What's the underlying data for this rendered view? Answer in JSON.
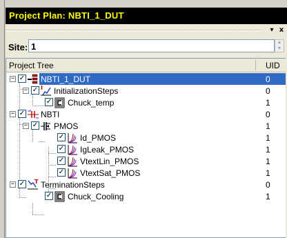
{
  "window": {
    "title": "Project Plan: NBTI_1_DUT"
  },
  "pane_buttons": {
    "menu": "▾",
    "close": "x"
  },
  "site": {
    "label": "Site:",
    "value": "1"
  },
  "tree_header": {
    "name_col": "Project Tree",
    "uid_col": "UID"
  },
  "tree": [
    {
      "label": "NBTI_1_DUT",
      "uid": "0"
    },
    {
      "label": "InitializationSteps",
      "uid": "0"
    },
    {
      "label": "Chuck_temp",
      "uid": "1"
    },
    {
      "label": "NBTI",
      "uid": "0"
    },
    {
      "label": "PMOS",
      "uid": "1"
    },
    {
      "label": "Id_PMOS",
      "uid": "1"
    },
    {
      "label": "IgLeak_PMOS",
      "uid": "1"
    },
    {
      "label": "VtextLin_PMOS",
      "uid": "1"
    },
    {
      "label": "VtextSat_PMOS",
      "uid": "1"
    },
    {
      "label": "TerminationSteps",
      "uid": "0"
    },
    {
      "label": "Chuck_Cooling",
      "uid": "1"
    }
  ],
  "colors": {
    "selection": "#316ac5",
    "title_text": "#ffff00",
    "title_bg": "#000000"
  }
}
